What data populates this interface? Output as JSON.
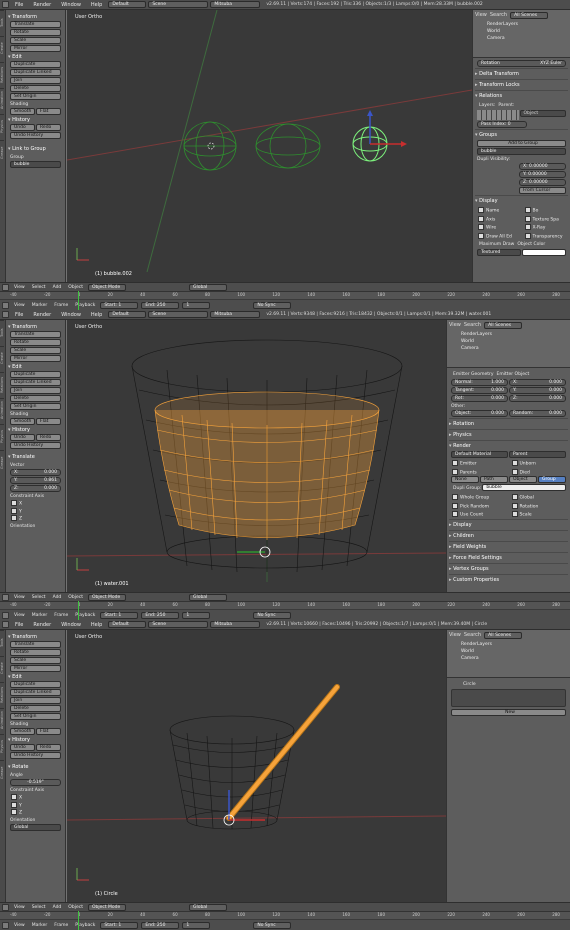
{
  "colors": {
    "accent": "#f6a33b",
    "selected": "#5680c2",
    "grid": "#4a4a4a",
    "x_axis": "#c23e3e",
    "y_axis": "#6aa84f"
  },
  "common": {
    "menus": [
      "File",
      "Render",
      "Window",
      "Help"
    ],
    "timeline_menus": [
      "View",
      "Marker",
      "Frame",
      "Playback"
    ],
    "view_menus": [
      "View",
      "Select",
      "Add",
      "Object"
    ],
    "mode": "Object Mode",
    "orientation": "Global",
    "start_label": "Start:",
    "start_val": "1",
    "end_label": "End:",
    "end_val": "250",
    "frame_val": "1",
    "sync": "No Sync",
    "ruler": [
      "-40",
      "-20",
      "0",
      "20",
      "40",
      "60",
      "80",
      "100",
      "120",
      "140",
      "160",
      "180",
      "200",
      "220",
      "240",
      "260",
      "280"
    ],
    "history_title": "History",
    "undo": "Undo",
    "redo": "Redo",
    "undo_history": "Undo History",
    "transform_title": "Transform",
    "translate": "Translate",
    "rotate": "Rotate",
    "scale": "Scale",
    "mirror": "Mirror",
    "edit_title": "Edit",
    "duplicate": "Duplicate",
    "duplicate_linked": "Duplicate Linked",
    "join": "Join",
    "delete": "Delete",
    "set_origin": "Set Origin",
    "shading": "Shading",
    "smooth": "Smooth",
    "flat": "Flat",
    "vp_title": "User Ortho",
    "all_scenes": "All Scenes",
    "view": "View",
    "search": "Search",
    "renderlayers": "RenderLayers",
    "world": "World",
    "camera": "Camera"
  },
  "shots": [
    {
      "layout": "Default",
      "scene": "Scene",
      "engine": "Mitsuba",
      "info": "v2.69.11 | Verts:174 | Faces:192 | Tris:336 | Objects:1/3 | Lamps:0/0 | Mem:28.33M | bubble.002",
      "obj": "(1) bubble.002",
      "extra_title": "Link to Group",
      "group_label": "Group",
      "group_val": "bubble",
      "rotation_label": "Rotation",
      "rotation_val": "XYZ Euler",
      "props": [
        "Delta Transform",
        "Transform Locks",
        "Relations"
      ],
      "layers_label": "Layers:",
      "parent_label": "Parent:",
      "object_field": "Object",
      "pass_index": "Pass Index: 0",
      "groups_title": "Groups",
      "add_group": "Add to Group",
      "group_name": "bubble",
      "dupli_label": "Dupli Visibility:",
      "gx": "X: 0.00000",
      "gy": "Y: 0.00000",
      "gz": "Z: 0.00000",
      "from_cursor": "From Cursor",
      "display_title": "Display",
      "display_opts": [
        "Name",
        "Bo",
        "Axis",
        "Texture Spa",
        "Wire",
        "X-Ray",
        "Draw All Ed",
        "Transparency"
      ],
      "max_draw": "Maximum Draw",
      "textured": "Textured",
      "obj_color": "Object Color"
    },
    {
      "layout": "Default",
      "scene": "Scene",
      "engine": "Mitsuba",
      "info": "v2.69.11 | Verts:9348 | Faces:9216 | Tris:18432 | Objects:0/1 | Lamps:0/1 | Mem:39.32M | water.001",
      "obj": "(1) water.001",
      "extra_title": "Translate",
      "vector_label": "Vector",
      "vx": "X:",
      "vxv": "0.000",
      "vy": "Y:",
      "vyv": "0.861",
      "vz": "Z:",
      "vzv": "0.000",
      "constraint": "Constraint Axis",
      "axes": [
        "X",
        "Y",
        "Z"
      ],
      "orientation_label": "Orientation",
      "emitter_geom": "Emitter Geometry",
      "emitter_obj": "Emitter Object",
      "normal": "Normal:",
      "normal_v": "1.000",
      "tangent": "Tangent:",
      "tangent_v": "0.000",
      "rot": "Rot:",
      "rot_v": "0.000",
      "ex": "X:",
      "exv": "0.000",
      "ey": "Y:",
      "eyv": "0.000",
      "ez": "Z:",
      "ezv": "0.000",
      "other": "Other:",
      "object_label": "Object:",
      "object_v": "0.000",
      "random_label": "Random:",
      "random_v": "0.000",
      "sections": [
        "Rotation",
        "Physics",
        "Render"
      ],
      "material": "Default Material",
      "parent": "Parent",
      "emitter": "Emitter",
      "unborn": "Unborn",
      "parents": "Parents",
      "died": "Died",
      "render_modes": [
        "None",
        "Path",
        "Object",
        "Group"
      ],
      "dupli_group": "Dupli Group:",
      "dupli_group_val": "bubble",
      "whole_group": "Whole Group",
      "global": "Global",
      "pick_random": "Pick Random",
      "rotation": "Rotation",
      "use_count": "Use Count",
      "scale_opt": "Scale",
      "more": [
        "Display",
        "Children",
        "Field Weights",
        "Force Field Settings",
        "Vertex Groups",
        "Custom Properties"
      ]
    },
    {
      "layout": "Default",
      "scene": "Scene",
      "engine": "Mitsuba",
      "info": "v2.69.11 | Verts:10660 | Faces:10496 | Tris:20992 | Objects:1/7 | Lamps:0/1 | Mem:39.40M | Circle",
      "obj": "(1) Circle",
      "extra_title": "Rotate",
      "angle_label": "Angle",
      "angle_val": "-0.519°",
      "constraint": "Constraint Axis",
      "axes": [
        "X",
        "Y",
        "Z"
      ],
      "orientation_label": "Orientation",
      "orientation_val": "Global",
      "crumb": "Circle",
      "new_btn": "New"
    }
  ]
}
